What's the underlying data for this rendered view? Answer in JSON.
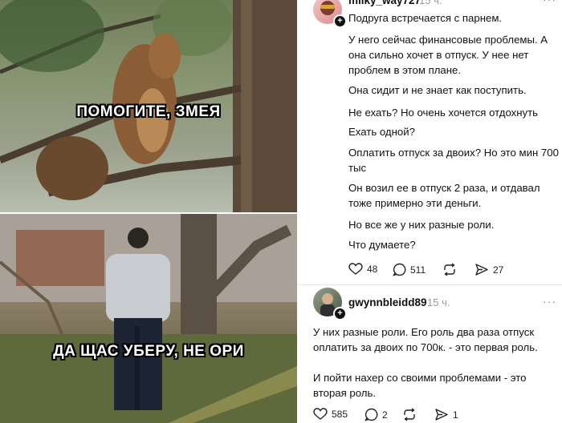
{
  "meme": {
    "top_caption": "ПОМОГИТЕ, ЗМЕЯ",
    "bottom_caption": "ДА ЩАС УБЕРУ, НЕ ОРИ"
  },
  "post": {
    "username": "milky_way727",
    "time": "15 ч.",
    "paragraphs": [
      "Подруга встречается с парнем.",
      "У него сейчас финансовые проблемы. А она сильно хочет в отпуск. У нее нет проблем в этом плане.",
      "Она сидит и не знает как поступить.",
      "Не ехать? Но очень хочется отдохнуть",
      "Ехать одной?",
      "Оплатить отпуск за двоих? Но это мин 700 тыс",
      "Он возил ее в отпуск 2 раза, и отдавал тоже примерно эти деньги.",
      "Но все же у них разные роли.",
      "Что думаете?"
    ],
    "likes": "48",
    "comments": "511",
    "reposts": "",
    "shares": "27"
  },
  "reply": {
    "username": "gwynnbleidd89",
    "time": "15 ч.",
    "paragraphs": [
      "У них разные роли. Его роль два раза отпуск оплатить за двоих по 700к. - это первая роль.",
      "И пойти нахер со своими проблемами - это вторая роль."
    ],
    "likes": "585",
    "comments": "2",
    "reposts": "",
    "shares": "1"
  }
}
